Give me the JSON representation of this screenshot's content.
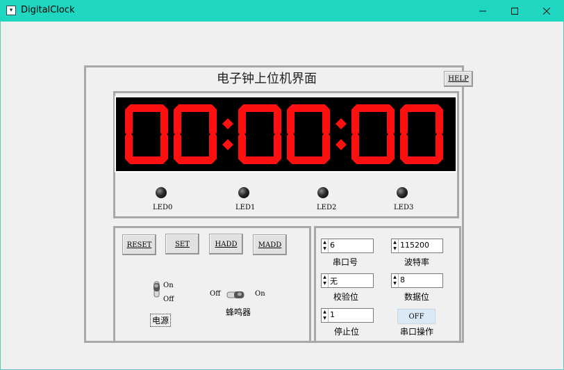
{
  "window": {
    "title": "DigitalClock"
  },
  "heading": "电子钟上位机界面",
  "help_label": "HELP",
  "clock": {
    "time": "00:00:00",
    "color": "#ff1010"
  },
  "leds": [
    {
      "label": "LED0"
    },
    {
      "label": "LED1"
    },
    {
      "label": "LED2"
    },
    {
      "label": "LED3"
    }
  ],
  "controls": {
    "buttons": [
      "RESET",
      "SET",
      "HADD",
      "MADD"
    ],
    "power": {
      "on": "On",
      "off": "Off",
      "caption": "电源"
    },
    "buzzer": {
      "off": "Off",
      "on": "On",
      "caption": "蜂鸣器"
    }
  },
  "serial": {
    "port": {
      "value": "6",
      "caption": "串口号"
    },
    "baud": {
      "value": "115200",
      "caption": "波特率"
    },
    "parity": {
      "value": "无",
      "caption": "校验位"
    },
    "databits": {
      "value": "8",
      "caption": "数据位"
    },
    "stopbits": {
      "value": "1",
      "caption": "停止位"
    },
    "operation": {
      "button": "OFF",
      "caption": "串口操作"
    }
  }
}
